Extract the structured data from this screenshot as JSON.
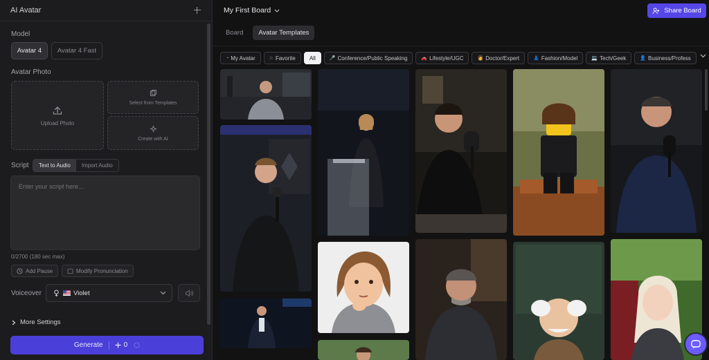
{
  "left_panel": {
    "title": "AI Avatar",
    "model": {
      "label": "Model",
      "options": [
        "Avatar 4",
        "Avatar 4 Fast"
      ],
      "selected": "Avatar 4"
    },
    "avatar_photo": {
      "label": "Avatar Photo",
      "upload_label": "Upload Photo",
      "templates_label": "Select from Templates",
      "ai_label": "Create with AI"
    },
    "script": {
      "label": "Script",
      "modes": [
        "Text to Audio",
        "Import Audio"
      ],
      "selected_mode": "Text to Audio",
      "placeholder": "Enter your script here...",
      "counter": "0/2700 (180 sec max)",
      "add_pause": "Add Pause",
      "modify_pronunciation": "Modify Pronunciation"
    },
    "voiceover": {
      "label": "Voiceover",
      "selected_voice": "Violet"
    },
    "more_settings": "More Settings",
    "generate": {
      "label": "Generate",
      "cost": "0"
    }
  },
  "right_panel": {
    "board_title": "My First Board",
    "share_label": "Share Board",
    "tabs": [
      "Board",
      "Avatar Templates"
    ],
    "active_tab": "Avatar Templates",
    "filters": [
      "My Avatar",
      "Favorite",
      "All",
      "Conference/Public Speaking",
      "Lifestyle/UGC",
      "Doctor/Expert",
      "Fashion/Model",
      "Tech/Geek",
      "Business/Profess"
    ],
    "active_filter": "All"
  },
  "colors": {
    "accent": "#5546e8",
    "generate": "#4b3fd9",
    "panel": "#1c1c1e",
    "background": "#121213"
  }
}
